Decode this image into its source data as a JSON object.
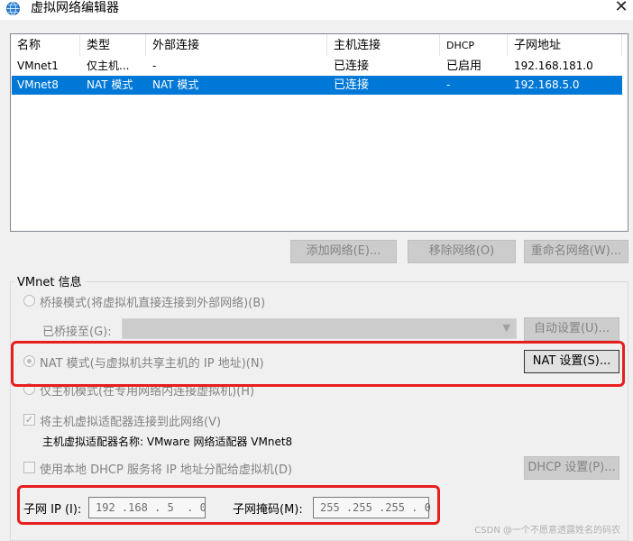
{
  "window": {
    "title": "虚拟网络编辑器",
    "icon": "globe-network-icon",
    "close_glyph": "✕"
  },
  "table": {
    "columns": [
      "名称",
      "类型",
      "外部连接",
      "主机连接",
      "DHCP",
      "子网地址"
    ],
    "rows": [
      {
        "name": "VMnet1",
        "type": "仅主机...",
        "external": "-",
        "host": "已连接",
        "dhcp": "已启用",
        "subnet": "192.168.181.0",
        "selected": false
      },
      {
        "name": "VMnet8",
        "type": "NAT 模式",
        "external": "NAT 模式",
        "host": "已连接",
        "dhcp": "-",
        "subnet": "192.168.5.0",
        "selected": true
      }
    ]
  },
  "buttons": {
    "add_network": "添加网络(E)...",
    "remove_network": "移除网络(O)",
    "rename_network": "重命名网络(W)..."
  },
  "vmnet_info": {
    "group_label": "VMnet 信息",
    "bridge_mode": "桥接模式(将虚拟机直接连接到外部网络)(B)",
    "bridged_to_label": "已桥接至(G):",
    "auto_settings": "自动设置(U)...",
    "nat_mode": "NAT 模式(与虚拟机共享主机的 IP 地址)(N)",
    "nat_settings": "NAT 设置(S)...",
    "host_only": "仅主机模式(在专用网络内连接虚拟机)(H)",
    "connect_adapter": "将主机虚拟适配器连接到此网络(V)",
    "adapter_name": "主机虚拟适配器名称: VMware 网络适配器 VMnet8",
    "use_dhcp": "使用本地 DHCP 服务将 IP 地址分配给虚拟机(D)",
    "dhcp_settings": "DHCP 设置(P)...",
    "subnet_ip_label": "子网 IP (I):",
    "subnet_ip_value": "192 .168 . 5  . 0",
    "subnet_mask_label": "子网掩码(M):",
    "subnet_mask_value": "255 .255 .255 . 0"
  },
  "watermark": "CSDN @一个不愿意透露姓名的码农",
  "colors": {
    "selection": "#0078d7",
    "highlight_box": "#e81e1e"
  }
}
